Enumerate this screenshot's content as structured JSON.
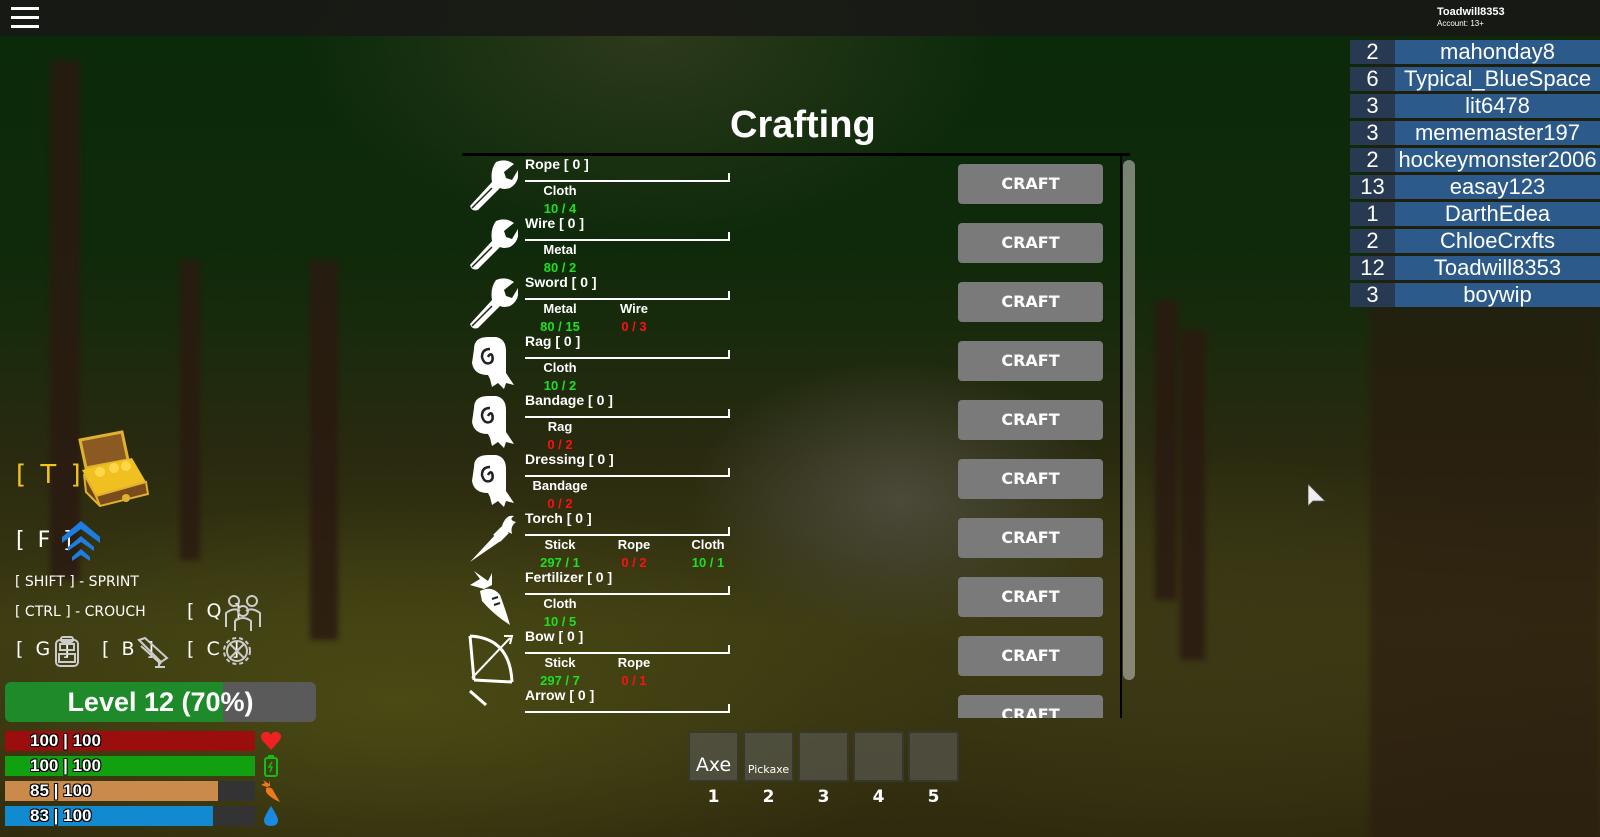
{
  "topbar": {
    "menu_icon": "hamburger-menu-icon",
    "account_name": "Toadwill8353",
    "account_age": "Account: 13+"
  },
  "leaderboard": [
    {
      "score": "2",
      "name": "mahonday8"
    },
    {
      "score": "6",
      "name": "Typical_BlueSpace"
    },
    {
      "score": "3",
      "name": "lit6478"
    },
    {
      "score": "3",
      "name": "mememaster197"
    },
    {
      "score": "2",
      "name": "hockeymonster2006"
    },
    {
      "score": "13",
      "name": "easay123"
    },
    {
      "score": "1",
      "name": "DarthEdea"
    },
    {
      "score": "2",
      "name": "ChloeCrxfts"
    },
    {
      "score": "12",
      "name": "Toadwill8353"
    },
    {
      "score": "3",
      "name": "boywip"
    }
  ],
  "crafting": {
    "title": "Crafting",
    "craft_label": "CRAFT",
    "recipes": [
      {
        "name": "Rope [ 0 ]",
        "icon": "wrench-icon",
        "ingredients": [
          {
            "name": "Cloth",
            "qty": "10 / 4",
            "ok": true
          }
        ]
      },
      {
        "name": "Wire [ 0 ]",
        "icon": "wrench-icon",
        "ingredients": [
          {
            "name": "Metal",
            "qty": "80 / 2",
            "ok": true
          }
        ]
      },
      {
        "name": "Sword [ 0 ]",
        "icon": "wrench-icon",
        "ingredients": [
          {
            "name": "Metal",
            "qty": "80 / 15",
            "ok": true
          },
          {
            "name": "Wire",
            "qty": "0 / 3",
            "ok": false
          }
        ]
      },
      {
        "name": "Rag [ 0 ]",
        "icon": "cloth-roll-icon",
        "ingredients": [
          {
            "name": "Cloth",
            "qty": "10 / 2",
            "ok": true
          }
        ]
      },
      {
        "name": "Bandage [ 0 ]",
        "icon": "cloth-roll-icon",
        "ingredients": [
          {
            "name": "Rag",
            "qty": "0 / 2",
            "ok": false
          }
        ]
      },
      {
        "name": "Dressing [ 0 ]",
        "icon": "cloth-roll-icon",
        "ingredients": [
          {
            "name": "Bandage",
            "qty": "0 / 2",
            "ok": false
          }
        ]
      },
      {
        "name": "Torch [ 0 ]",
        "icon": "torch-icon",
        "ingredients": [
          {
            "name": "Stick",
            "qty": "297 / 1",
            "ok": true
          },
          {
            "name": "Rope",
            "qty": "0 / 2",
            "ok": false
          },
          {
            "name": "Cloth",
            "qty": "10 / 1",
            "ok": true
          }
        ]
      },
      {
        "name": "Fertilizer [ 0 ]",
        "icon": "carrot-icon",
        "ingredients": [
          {
            "name": "Cloth",
            "qty": "10 / 5",
            "ok": true
          }
        ]
      },
      {
        "name": "Bow [ 0 ]",
        "icon": "bow-icon",
        "ingredients": [
          {
            "name": "Stick",
            "qty": "297 / 7",
            "ok": true
          },
          {
            "name": "Rope",
            "qty": "0 / 1",
            "ok": false
          }
        ]
      },
      {
        "name": "Arrow [ 0 ]",
        "icon": "arrow-icon",
        "ingredients": []
      }
    ]
  },
  "hotkeys": {
    "treasure": "[ T ]",
    "boost": "[ F ]",
    "sprint": "[ SHIFT ] - SPRINT",
    "crouch": "[ CTRL ] - CROUCH",
    "team": "[ Q ]",
    "backpack": "[ G ]",
    "build": "[ B ]",
    "craft": "[ C ]"
  },
  "level": {
    "text": "Level 12 (70%)",
    "progress": 0.7
  },
  "stats": [
    {
      "name": "health",
      "text": "100 | 100",
      "value": 100,
      "max": 100,
      "color": "#9a0e0e",
      "icon": "heart-icon"
    },
    {
      "name": "energy",
      "text": "100 | 100",
      "value": 100,
      "max": 100,
      "color": "#10a010",
      "icon": "battery-icon"
    },
    {
      "name": "hunger",
      "text": "85 | 100",
      "value": 85,
      "max": 100,
      "color": "#c98a4c",
      "icon": "carrot-icon"
    },
    {
      "name": "thirst",
      "text": "83 | 100",
      "value": 83,
      "max": 100,
      "color": "#118ad0",
      "icon": "water-drop-icon"
    }
  ],
  "hotbar": [
    {
      "num": "1",
      "label": "Axe"
    },
    {
      "num": "2",
      "label": "Pickaxe"
    },
    {
      "num": "3",
      "label": ""
    },
    {
      "num": "4",
      "label": ""
    },
    {
      "num": "5",
      "label": ""
    }
  ]
}
